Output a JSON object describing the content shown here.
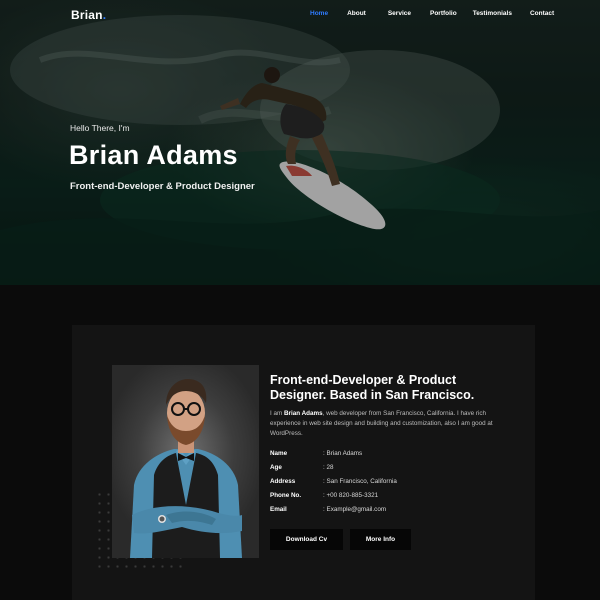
{
  "nav": {
    "logo_text": "Brian",
    "logo_dot": ".",
    "items": [
      {
        "label": "Home",
        "active": true
      },
      {
        "label": "About",
        "active": false
      },
      {
        "label": "Service",
        "active": false
      },
      {
        "label": "Portfolio",
        "active": false
      },
      {
        "label": "Testimonials",
        "active": false
      },
      {
        "label": "Contact",
        "active": false
      }
    ]
  },
  "hero": {
    "greeting": "Hello There, I'm",
    "name": "Brian Adams",
    "role": "Front-end-Developer & Product Designer"
  },
  "about": {
    "title": "Front-end-Developer & Product Designer. Based in San Francisco.",
    "intro_prefix": "I am ",
    "intro_name": "Brian Adams",
    "intro_rest": ", web developer from San Francisco, California. I have rich experience in web site design and building and customization, also I am good at WordPress.",
    "details": [
      {
        "label": "Name",
        "value": ": Brian Adams"
      },
      {
        "label": "Age",
        "value": ": 28"
      },
      {
        "label": "Address",
        "value": ": San Francisco, California"
      },
      {
        "label": "Phone No.",
        "value": ": +00 820-885-3321"
      },
      {
        "label": "Email",
        "value": ": Example@gmail.com"
      }
    ],
    "buttons": {
      "download_cv": "Download Cv",
      "more_info": "More Info"
    }
  },
  "colors": {
    "accent": "#2f7cff",
    "page_bg": "#0b0b0b",
    "card_bg": "#141414",
    "button_bg": "#060606"
  }
}
